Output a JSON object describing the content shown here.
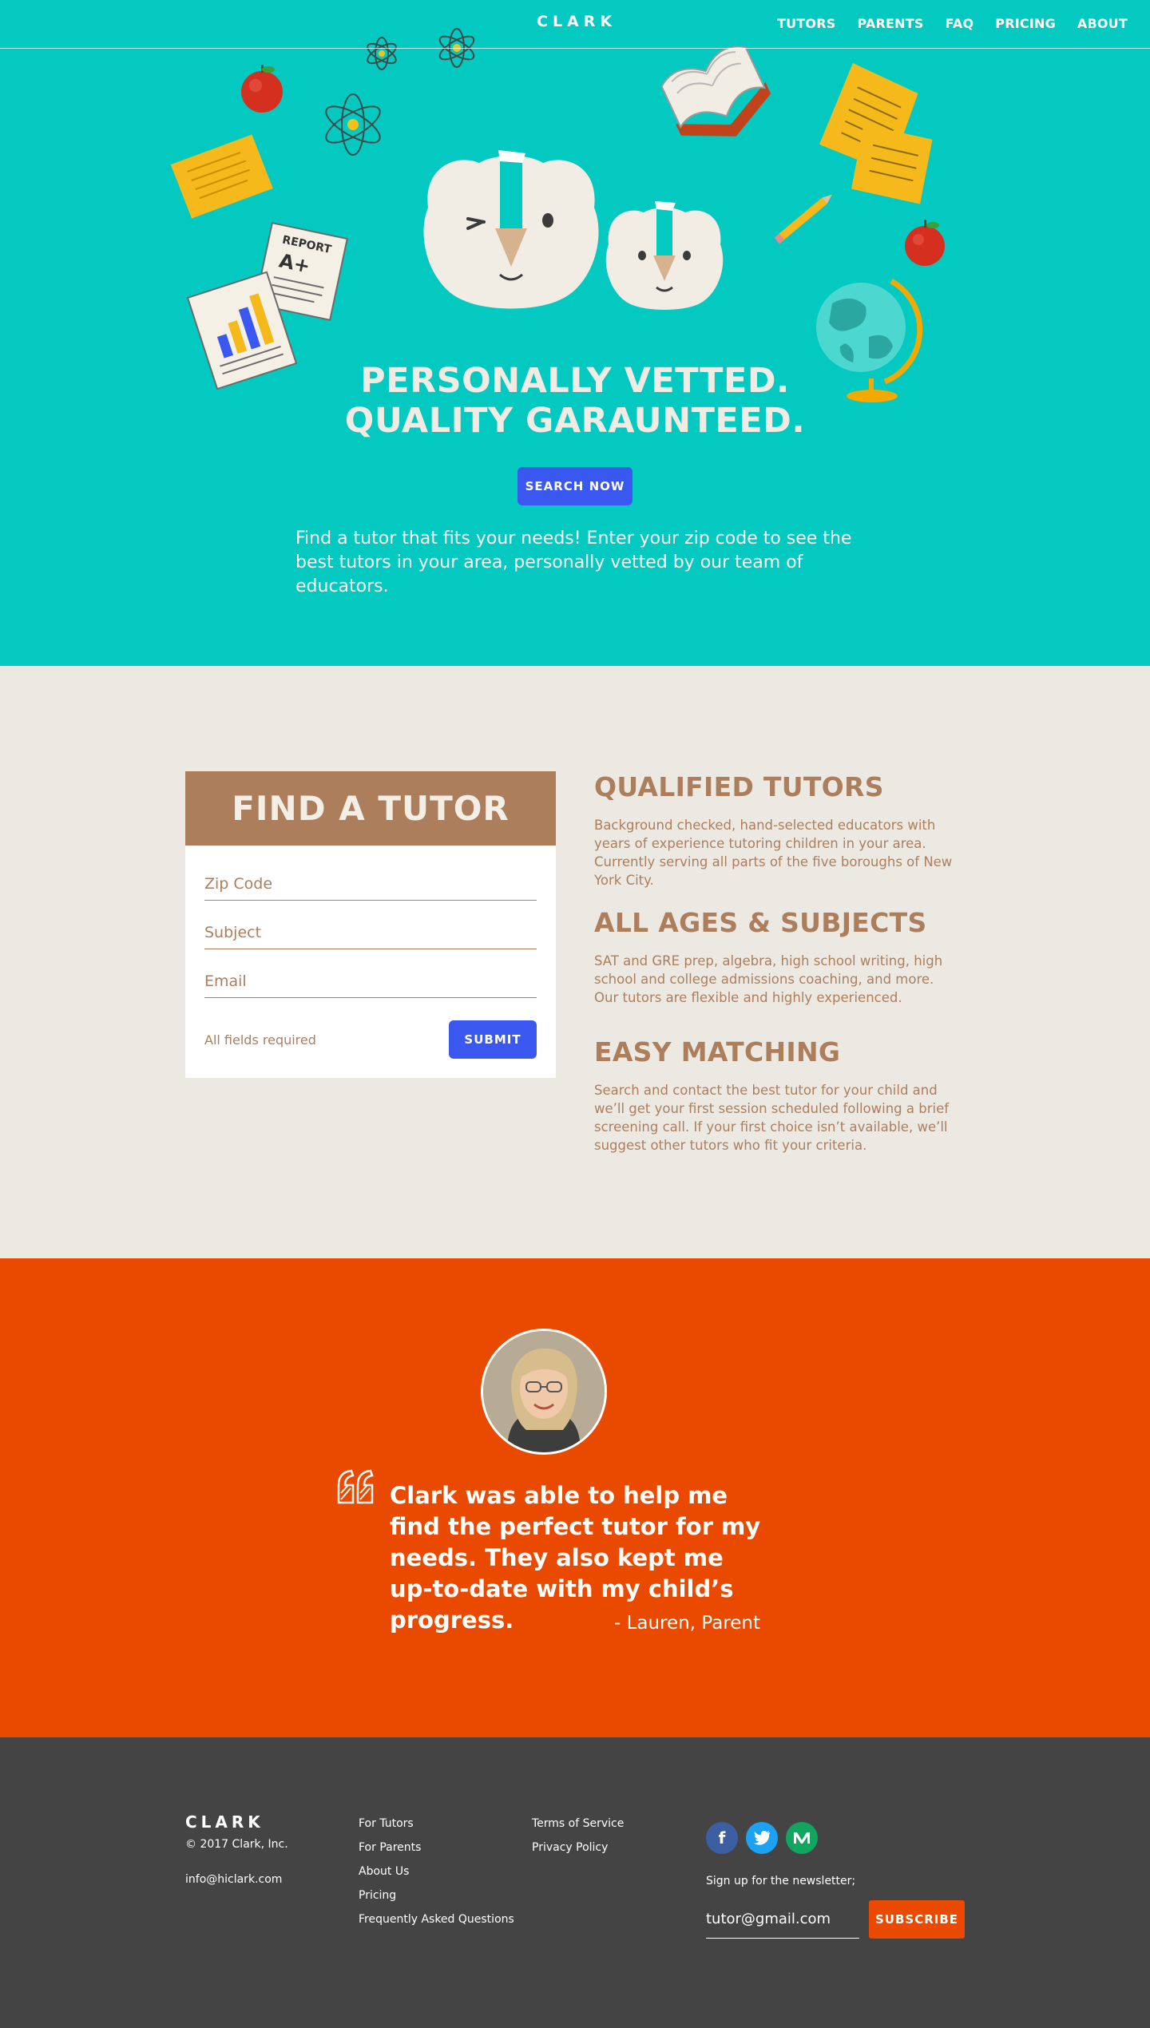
{
  "brand": {
    "logo": "CLARK"
  },
  "nav": {
    "items": [
      "TUTORS",
      "PARENTS",
      "FAQ",
      "PRICING",
      "ABOUT"
    ]
  },
  "hero": {
    "title_line1": "PERSONALLY VETTED.",
    "title_line2": "QUALITY GARAUNTEED.",
    "cta": "SEARCH NOW",
    "description": "Find a tutor that fits your needs! Enter your zip code to see the best tutors in your area, personally vetted by our team of educators.",
    "report_label": "REPORT",
    "report_grade": "A+"
  },
  "form": {
    "title": "FIND A TUTOR",
    "zip_placeholder": "Zip Code",
    "subject_placeholder": "Subject",
    "email_placeholder": "Email",
    "required_note": "All fields required",
    "submit": "SUBMIT"
  },
  "features": [
    {
      "title": "QUALIFIED TUTORS",
      "text": "Background checked, hand-selected educators with years of experience tutoring children in your area. Currently serving all parts of the five boroughs of New York City."
    },
    {
      "title": "ALL AGES & SUBJECTS",
      "text": "SAT and GRE prep, algebra, high school writing, high school and college admissions coaching, and more. Our tutors are flexible and highly experienced."
    },
    {
      "title": "EASY MATCHING",
      "text": "Search and contact the best tutor for your child and we’ll get your first session scheduled following a brief screening call. If your first choice isn’t available, we’ll suggest other tutors who fit your criteria."
    }
  ],
  "testimonial": {
    "quote": "Clark was able to help me find the perfect tutor for my needs. They also kept me up-to-date with my child’s progress.",
    "author": "- Lauren, Parent"
  },
  "footer": {
    "logo": "CLARK",
    "copyright": "© 2017 Clark, Inc.",
    "email": "info@hiclark.com",
    "col1": [
      "For Tutors",
      "For Parents",
      "About Us",
      "Pricing",
      "Frequently Asked Questions"
    ],
    "col2": [
      "Terms of Service",
      "Privacy Policy"
    ],
    "social_icons": [
      "facebook-icon",
      "twitter-icon",
      "medium-icon"
    ],
    "newsletter_label": "Sign up for the newsletter;",
    "newsletter_value": "tutor@gmail.com",
    "subscribe": "SUBSCRIBE"
  },
  "colors": {
    "hero_bg": "#04c9c0",
    "accent_blue": "#3a57f0",
    "brown": "#ad7e5c",
    "cream": "#ece9e2",
    "orange": "#ea4a00",
    "footer_bg": "#444444"
  }
}
